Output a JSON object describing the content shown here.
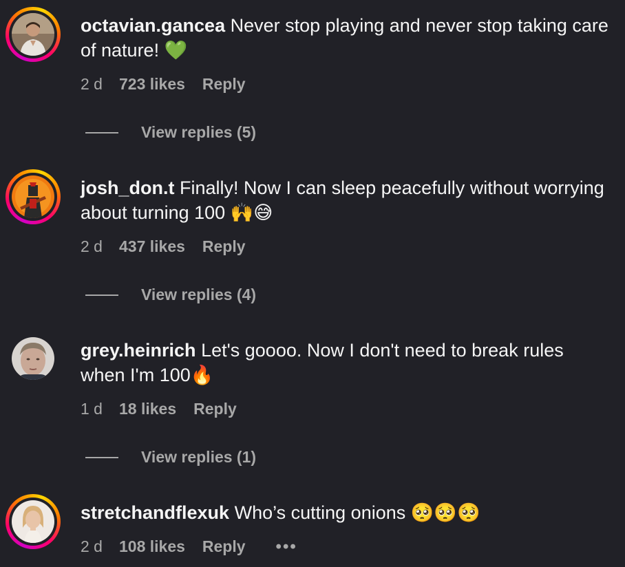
{
  "comments": [
    {
      "username": "octavian.gancea",
      "text": "Never stop playing and never stop taking care of nature! 💚",
      "time": "2 d",
      "likes": "723 likes",
      "reply": "Reply",
      "view_replies": "View replies (5)"
    },
    {
      "username": "josh_don.t",
      "text": "Finally! Now I can sleep peacefully without worrying about turning 100 🙌😅",
      "time": "2 d",
      "likes": "437 likes",
      "reply": "Reply",
      "view_replies": "View replies (4)"
    },
    {
      "username": "grey.heinrich",
      "text": "Let's goooo. Now I don't need to break rules when I'm 100🔥",
      "time": "1 d",
      "likes": "18 likes",
      "reply": "Reply",
      "view_replies": "View replies (1)"
    },
    {
      "username": "stretchandflexuk",
      "text": "Who’s cutting onions 🥺🥺🥺",
      "time": "2 d",
      "likes": "108 likes",
      "reply": "Reply",
      "more": "•••"
    }
  ],
  "colors": {
    "background": "#212127",
    "text": "#f5f5f5",
    "muted": "#a8a8a8",
    "story_ring": [
      "#d300c5",
      "#ff0069",
      "#ff7a00",
      "#ffd600"
    ]
  },
  "icons": {
    "more_options": "more-options-icon",
    "avatars": [
      "avatar-octavian",
      "avatar-josh",
      "avatar-grey",
      "avatar-stretch"
    ]
  }
}
